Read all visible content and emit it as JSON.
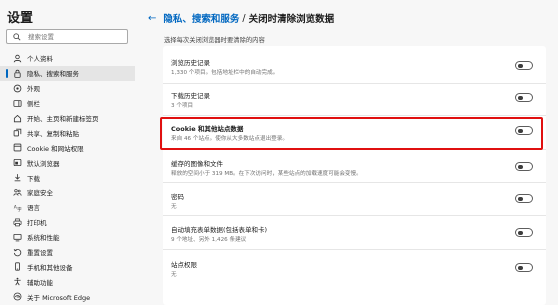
{
  "sidebar": {
    "title": "设置",
    "search_placeholder": "搜索设置",
    "items": [
      {
        "label": "个人资料",
        "icon": "profile-icon"
      },
      {
        "label": "隐私、搜索和服务",
        "icon": "lock-icon",
        "selected": true
      },
      {
        "label": "外观",
        "icon": "appearance-icon"
      },
      {
        "label": "侧栏",
        "icon": "sidebar-icon"
      },
      {
        "label": "开始、主页和新建标签页",
        "icon": "home-icon"
      },
      {
        "label": "共享、复制和粘贴",
        "icon": "share-icon"
      },
      {
        "label": "Cookie 和网站权限",
        "icon": "site-permissions-icon"
      },
      {
        "label": "默认浏览器",
        "icon": "browser-icon"
      },
      {
        "label": "下载",
        "icon": "download-icon"
      },
      {
        "label": "家庭安全",
        "icon": "family-icon"
      },
      {
        "label": "语言",
        "icon": "language-icon"
      },
      {
        "label": "打印机",
        "icon": "printer-icon"
      },
      {
        "label": "系统和性能",
        "icon": "system-icon"
      },
      {
        "label": "重置设置",
        "icon": "reset-icon"
      },
      {
        "label": "手机和其他设备",
        "icon": "phone-icon"
      },
      {
        "label": "辅助功能",
        "icon": "accessibility-icon"
      },
      {
        "label": "关于 Microsoft Edge",
        "icon": "edge-icon"
      }
    ]
  },
  "header": {
    "back_icon": "back-arrow-icon",
    "parent": "隐私、搜索和服务",
    "separator": "/",
    "current": "关闭时清除浏览数据"
  },
  "subheading": "选择每次关闭浏览器时要清除的内容",
  "rows": [
    {
      "title": "浏览历史记录",
      "subtitle": "1,330 个项目。包括地址栏中的自动完成。",
      "enabled": false
    },
    {
      "title": "下载历史记录",
      "subtitle": "3 个项目",
      "enabled": false
    },
    {
      "title": "Cookie 和其他站点数据",
      "subtitle": "来自 46 个站点。使你从大多数站点退出登录。",
      "enabled": false,
      "highlighted": true
    },
    {
      "title": "缓存的图像和文件",
      "subtitle": "释放的空间小于 319 MB。在下次访问时，某些站点的加载速度可能会变慢。",
      "enabled": false
    },
    {
      "title": "密码",
      "subtitle": "无",
      "enabled": false
    },
    {
      "title": "自动填充表单数据(包括表单和卡)",
      "subtitle": "9 个地址、另外 1,426 条建议",
      "enabled": false
    },
    {
      "title": "站点权限",
      "subtitle": "无",
      "enabled": false
    }
  ],
  "colors": {
    "accent": "#0067c0",
    "highlight": "#e01010"
  }
}
